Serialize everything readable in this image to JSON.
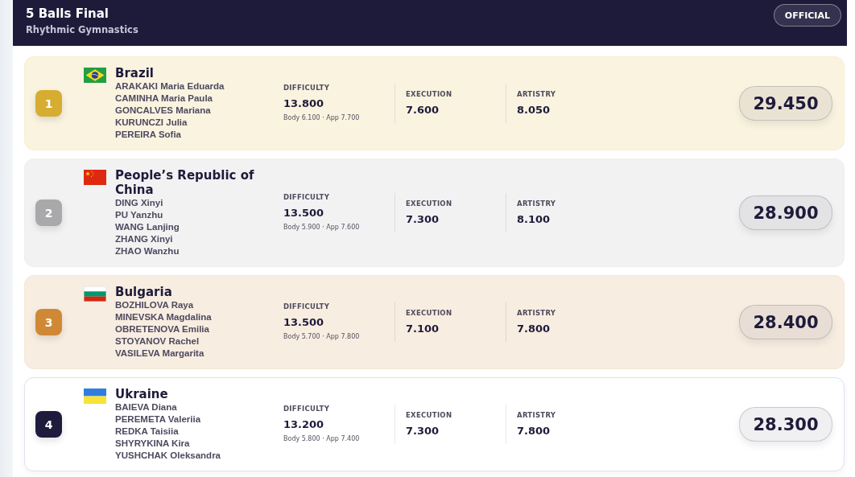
{
  "header": {
    "title": "5 Balls Final",
    "subtitle": "Rhythmic Gymnastics",
    "status": "OFFICIAL"
  },
  "results": [
    {
      "rank": "1",
      "color": "#d6ad30",
      "medal": true,
      "flag": {
        "kind": "brazil"
      },
      "country": "Brazil",
      "athletes": [
        "ARAKAKI Maria Eduarda",
        "CAMINHA Maria Paula",
        "GONCALVES Mariana",
        "KURUNCZI Julia",
        "PEREIRA Sofia"
      ],
      "difficulty": {
        "label": "DIFFICULTY",
        "value": "13.800",
        "detail": "Body 6.100 · App 7.700"
      },
      "execution": {
        "label": "EXECUTION",
        "value": "7.600"
      },
      "artistry": {
        "label": "ARTISTRY",
        "value": "8.050"
      },
      "total": "29.450"
    },
    {
      "rank": "2",
      "color": "#a9a9ac",
      "medal": true,
      "flag": {
        "kind": "china"
      },
      "country": "People’s Republic of China",
      "athletes": [
        "DING Xinyi",
        "PU Yanzhu",
        "WANG Lanjing",
        "ZHANG Xinyi",
        "ZHAO Wanzhu"
      ],
      "difficulty": {
        "label": "DIFFICULTY",
        "value": "13.500",
        "detail": "Body 5.900 · App 7.600"
      },
      "execution": {
        "label": "EXECUTION",
        "value": "7.300"
      },
      "artistry": {
        "label": "ARTISTRY",
        "value": "8.100"
      },
      "total": "28.900"
    },
    {
      "rank": "3",
      "color": "#cf8936",
      "medal": true,
      "flag": {
        "kind": "bulgaria"
      },
      "country": "Bulgaria",
      "athletes": [
        "BOZHILOVA Raya",
        "MINEVSKA Magdalina",
        "OBRETENOVA Emilia",
        "STOYANOV Rachel",
        "VASILEVA Margarita"
      ],
      "difficulty": {
        "label": "DIFFICULTY",
        "value": "13.500",
        "detail": "Body 5.700 · App 7.800"
      },
      "execution": {
        "label": "EXECUTION",
        "value": "7.100"
      },
      "artistry": {
        "label": "ARTISTRY",
        "value": "7.800"
      },
      "total": "28.400"
    },
    {
      "rank": "4",
      "color": "#1f1b3d",
      "medal": false,
      "flag": {
        "kind": "ukraine"
      },
      "country": "Ukraine",
      "athletes": [
        "BAIEVA Diana",
        "PEREMETA Valeriia",
        "REDKA Taisiia",
        "SHYRYKINA Kira",
        "YUSHCHAK Oleksandra"
      ],
      "difficulty": {
        "label": "DIFFICULTY",
        "value": "13.200",
        "detail": "Body 5.800 · App 7.400"
      },
      "execution": {
        "label": "EXECUTION",
        "value": "7.300"
      },
      "artistry": {
        "label": "ARTISTRY",
        "value": "7.800"
      },
      "total": "28.300"
    }
  ]
}
